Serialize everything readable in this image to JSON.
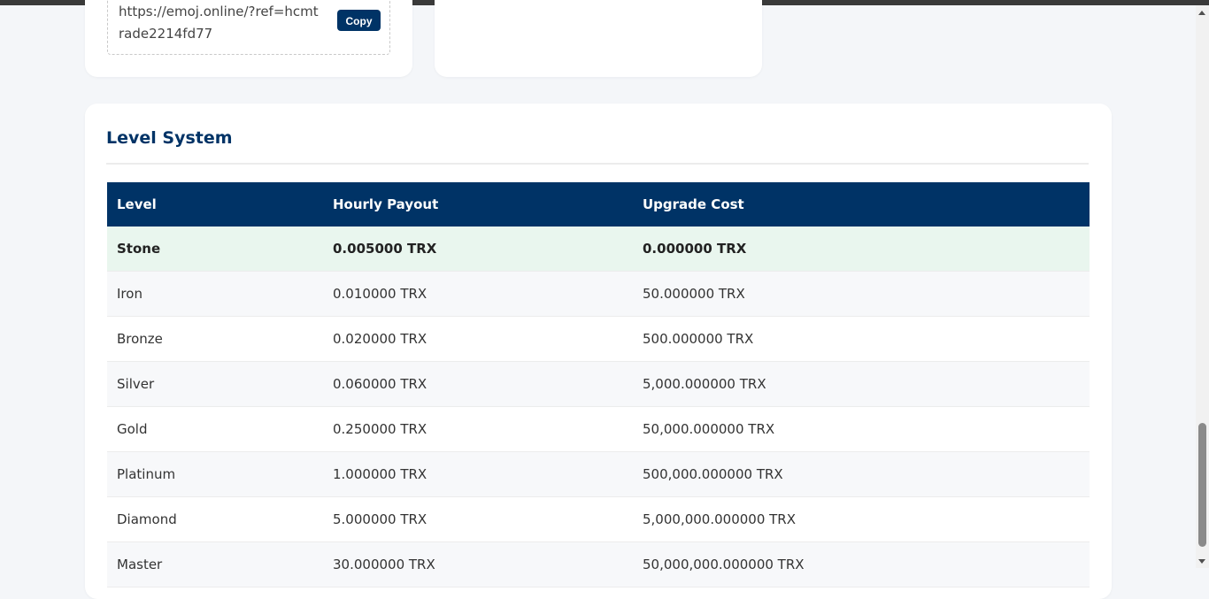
{
  "referral": {
    "link": "https://emoj.online/?ref=hcmtrade2214fd77",
    "copy_label": "Copy"
  },
  "level_system": {
    "title": "Level System",
    "columns": [
      "Level",
      "Hourly Payout",
      "Upgrade Cost"
    ],
    "rows": [
      {
        "level": "Stone",
        "payout": "0.005000 TRX",
        "cost": "0.000000 TRX",
        "current": true
      },
      {
        "level": "Iron",
        "payout": "0.010000 TRX",
        "cost": "50.000000 TRX"
      },
      {
        "level": "Bronze",
        "payout": "0.020000 TRX",
        "cost": "500.000000 TRX"
      },
      {
        "level": "Silver",
        "payout": "0.060000 TRX",
        "cost": "5,000.000000 TRX"
      },
      {
        "level": "Gold",
        "payout": "0.250000 TRX",
        "cost": "50,000.000000 TRX"
      },
      {
        "level": "Platinum",
        "payout": "1.000000 TRX",
        "cost": "500,000.000000 TRX"
      },
      {
        "level": "Diamond",
        "payout": "5.000000 TRX",
        "cost": "5,000,000.000000 TRX"
      },
      {
        "level": "Master",
        "payout": "30.000000 TRX",
        "cost": "50,000,000.000000 TRX"
      }
    ]
  },
  "colors": {
    "primary": "#003366",
    "current_row": "#e9f6ee",
    "background": "#f4f6f9"
  }
}
